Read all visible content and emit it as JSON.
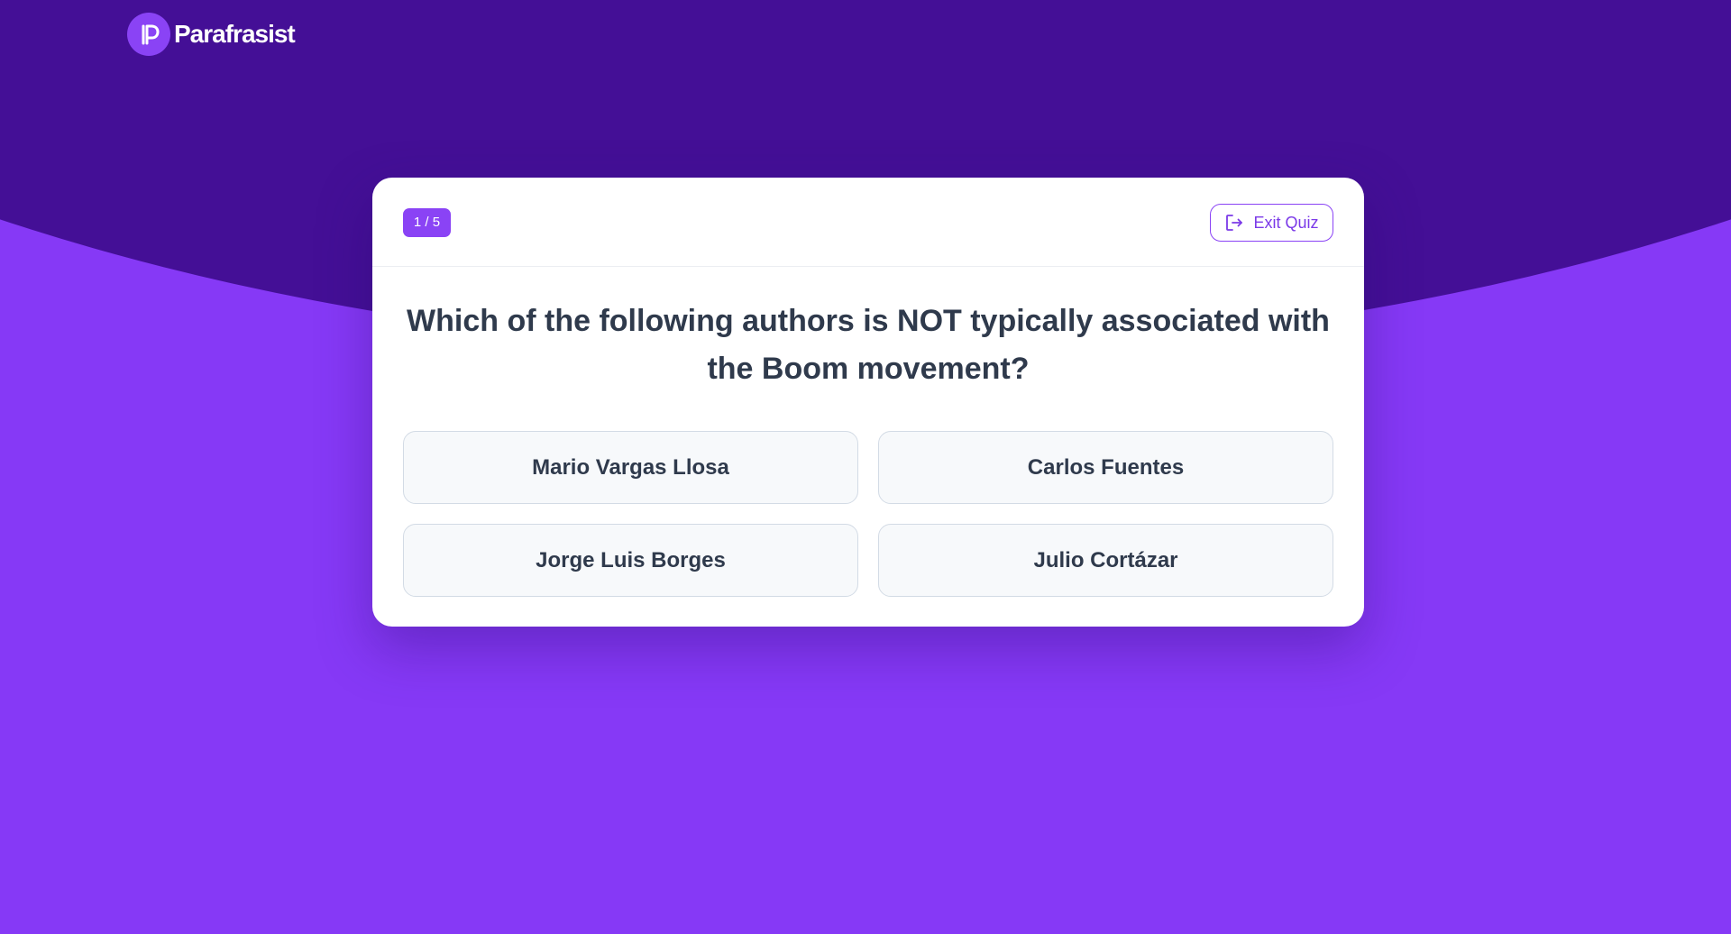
{
  "brand": {
    "name": "Parafrasist",
    "logo_icon": "parafrasist-logo-icon"
  },
  "quiz": {
    "progress": "1 / 5",
    "exit_label": "Exit Quiz",
    "exit_icon": "exit-icon",
    "question": "Which of the following authors is NOT typically associated with the Boom movement?",
    "options": [
      "Mario Vargas Llosa",
      "Carlos Fuentes",
      "Jorge Luis Borges",
      "Julio Cortázar"
    ]
  },
  "colors": {
    "header_background": "#440f96",
    "page_background": "#8639f6",
    "accent": "#8a43f5",
    "text": "#2f3a4c"
  }
}
